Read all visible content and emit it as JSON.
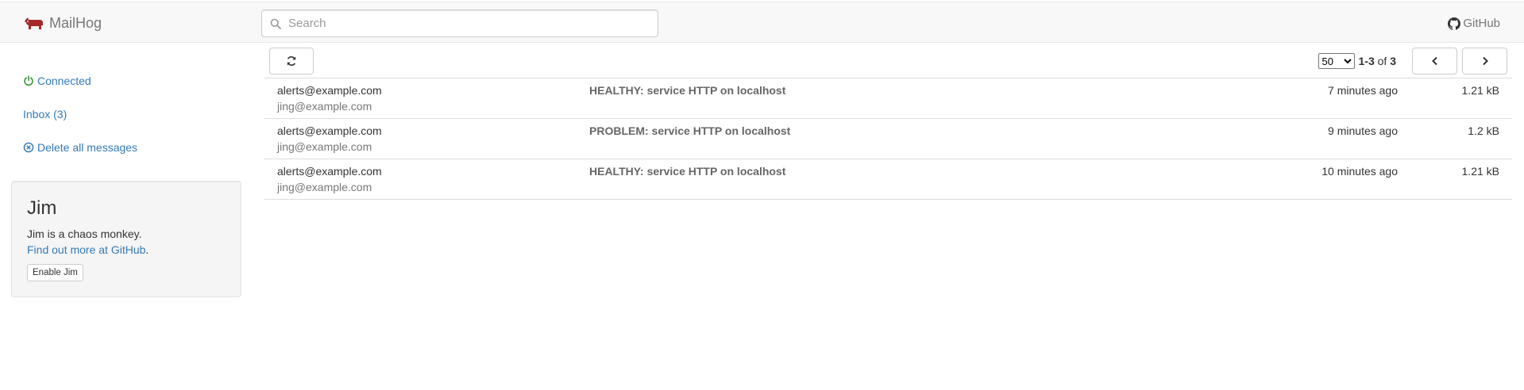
{
  "app": {
    "brand_text": "MailHog",
    "logo_icon": "mailhog-pig-logo",
    "brand_color": "#a52a2a",
    "link_color": "#337ab7",
    "success_color": "#3c9a3c"
  },
  "header": {
    "search_placeholder": "Search",
    "github_label": "GitHub"
  },
  "sidebar": {
    "connected_label": "Connected",
    "inbox_label": "Inbox (3)",
    "delete_all_label": "Delete all messages"
  },
  "jim": {
    "title": "Jim",
    "description": "Jim is a chaos monkey.",
    "link_text": "Find out more at GitHub",
    "link_suffix": ".",
    "enable_button": "Enable Jim"
  },
  "toolbar": {
    "refresh_icon": "refresh-icon",
    "per_page_selected": "50",
    "range_text": "1-3",
    "range_of": "of",
    "range_total": "3"
  },
  "messages": [
    {
      "from": "alerts@example.com",
      "to": "jing@example.com",
      "subject": "HEALTHY: service HTTP on localhost",
      "time": "7 minutes ago",
      "size": "1.21 kB"
    },
    {
      "from": "alerts@example.com",
      "to": "jing@example.com",
      "subject": "PROBLEM: service HTTP on localhost",
      "time": "9 minutes ago",
      "size": "1.2 kB"
    },
    {
      "from": "alerts@example.com",
      "to": "jing@example.com",
      "subject": "HEALTHY: service HTTP on localhost",
      "time": "10 minutes ago",
      "size": "1.21 kB"
    }
  ]
}
